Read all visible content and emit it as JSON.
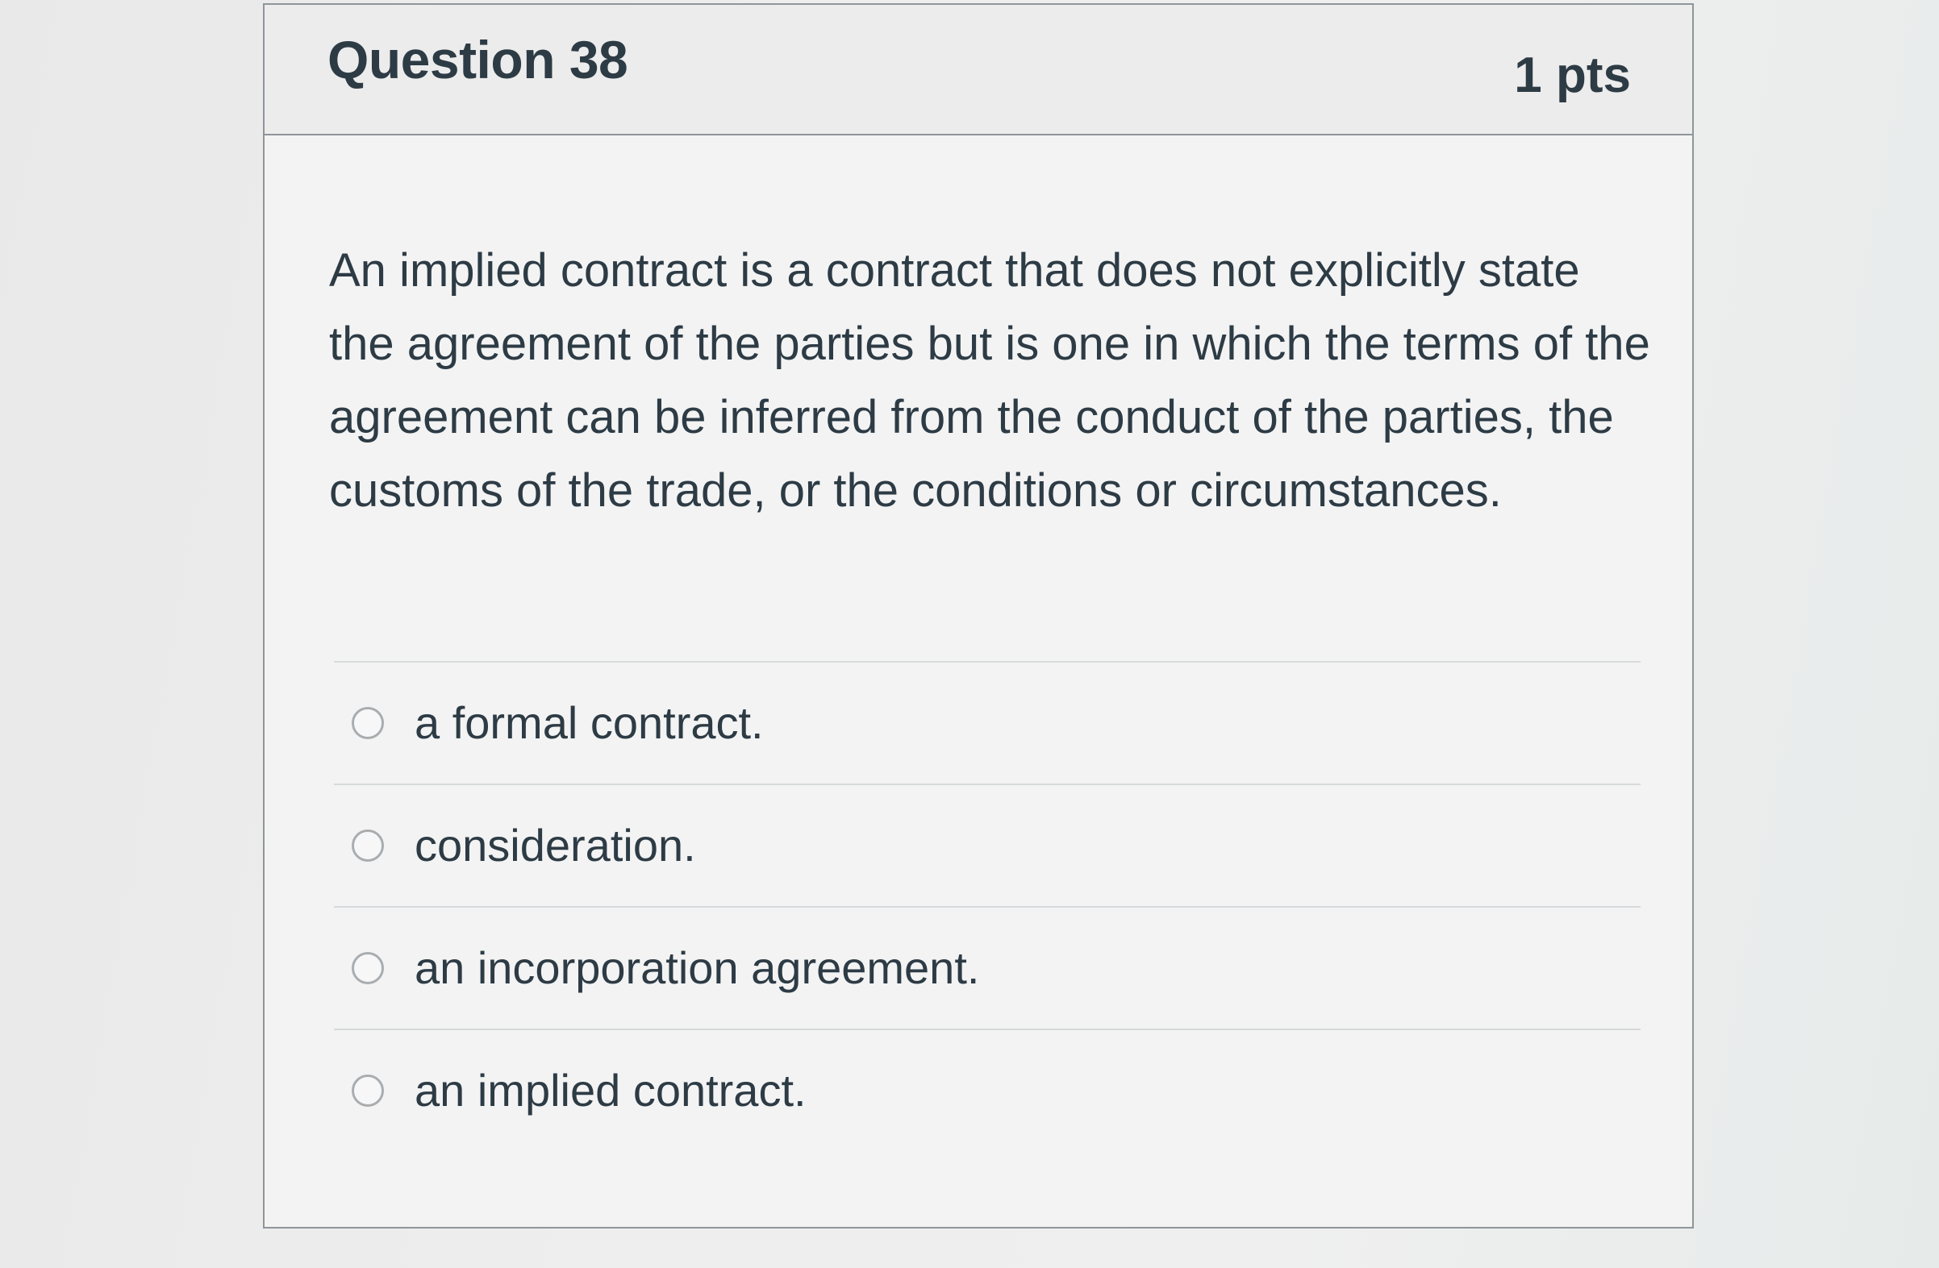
{
  "question": {
    "title": "Question 38",
    "points": "1 pts",
    "text": "An implied contract is a contract that does not explicitly state the agreement of the parties but is one in which the terms of the agreement can be inferred from the conduct of the parties, the customs of the trade, or the conditions or circumstances.",
    "answers": [
      {
        "label": "a formal contract."
      },
      {
        "label": "consideration."
      },
      {
        "label": "an incorporation agreement."
      },
      {
        "label": "an implied contract."
      }
    ]
  }
}
